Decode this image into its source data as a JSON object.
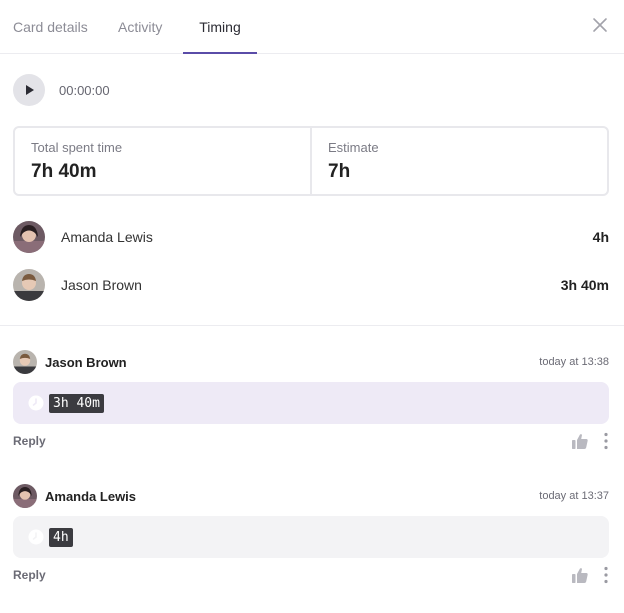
{
  "tabs": [
    {
      "label": "Card details"
    },
    {
      "label": "Activity"
    },
    {
      "label": "Timing"
    }
  ],
  "timer": {
    "elapsed": "00:00:00"
  },
  "summary": {
    "spent_label": "Total spent time",
    "spent_value": "7h 40m",
    "estimate_label": "Estimate",
    "estimate_value": "7h"
  },
  "people": [
    {
      "name": "Amanda Lewis",
      "time": "4h"
    },
    {
      "name": "Jason Brown",
      "time": "3h 40m"
    }
  ],
  "comments": [
    {
      "author": "Jason Brown",
      "stamp": "today at 13:38",
      "value": "3h 40m",
      "reply": "Reply"
    },
    {
      "author": "Amanda Lewis",
      "stamp": "today at 13:37",
      "value": "4h",
      "reply": "Reply"
    }
  ],
  "colors": {
    "accent": "#5a4ca8",
    "bubble_purple": "#eeeaf6",
    "bubble_grey": "#f3f3f5"
  }
}
